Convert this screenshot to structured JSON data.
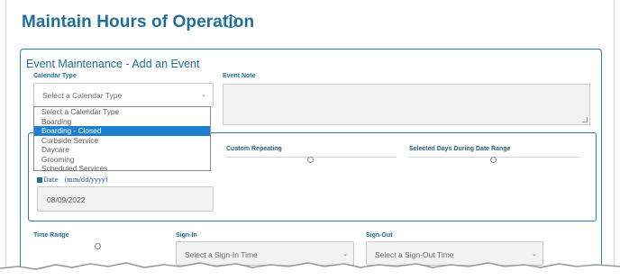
{
  "page": {
    "title": "Maintain Hours of Operation",
    "info_icon": "info-icon"
  },
  "panel": {
    "title": "Event Maintenance - Add an Event"
  },
  "calendar_type": {
    "label": "Calendar Type",
    "placeholder": "Select a Calendar Type",
    "options": [
      "Select a Calendar Type",
      "Boarding",
      "Boarding - Closed",
      "Curbside Service",
      "Daycare",
      "Grooming",
      "Scheduled Services"
    ],
    "highlighted": "Boarding - Closed"
  },
  "event_note": {
    "label": "Event Note",
    "value": ""
  },
  "repeat": {
    "custom_label": "Custom Repeating",
    "days_label": "Selected Days During Date Range"
  },
  "date": {
    "label": "Date",
    "format": "(mm/dd/yyyy)",
    "value": "08/09/2022"
  },
  "time": {
    "range_label": "Time Range",
    "signin_label": "Sign-In",
    "signin_placeholder": "Select a Sign-In Time",
    "signout_label": "Sign-Out",
    "signout_placeholder": "Select a Sign-Out Time"
  },
  "colors": {
    "accent": "#1f6f9a",
    "selection": "#1e7fd0",
    "panel_border": "#2a7fae"
  }
}
